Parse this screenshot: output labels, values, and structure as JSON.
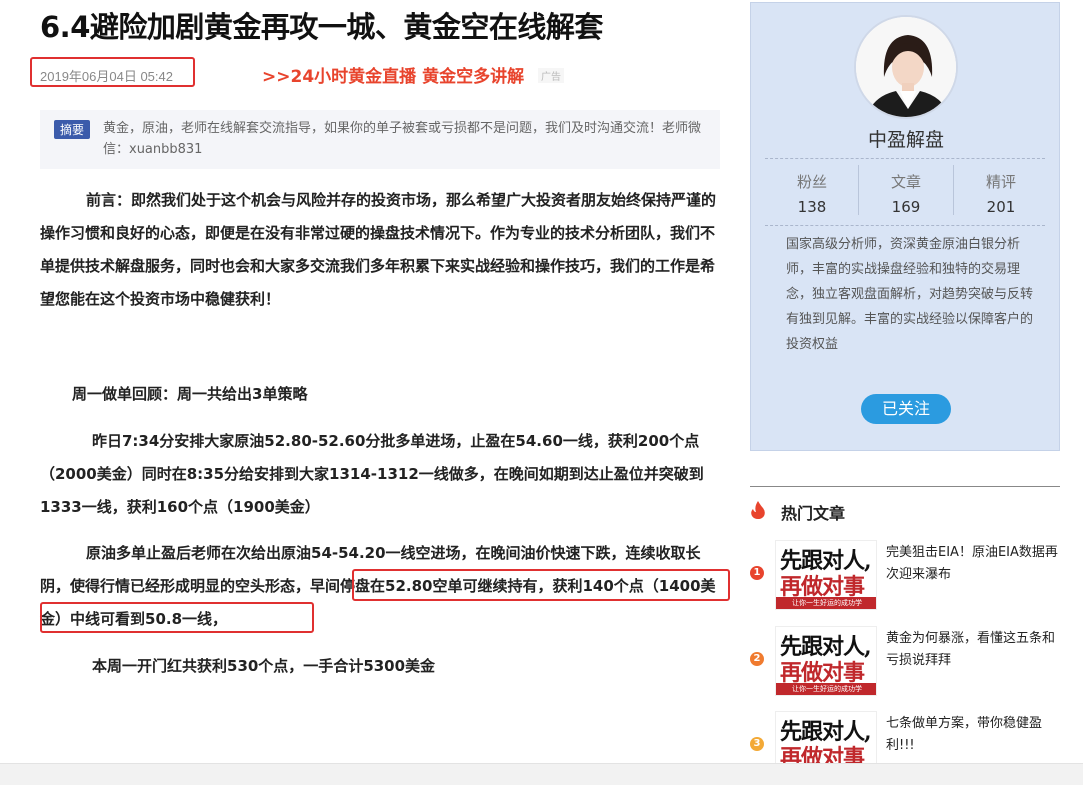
{
  "article": {
    "title": "6.4避险加剧黄金再攻一城、黄金空在线解套",
    "date": "2019年06月04日 05:42",
    "ad_link": ">>24小时黄金直播 黄金空多讲解",
    "ad_tag": "广告",
    "summary_label": "摘要",
    "summary_text": "黄金，原油，老师在线解套交流指导，如果你的单子被套或亏损都不是问题，我们及时沟通交流！老师微信：xuanbb831",
    "paragraphs": {
      "p1": "前言：即然我们处于这个机会与风险并存的投资市场，那么希望广大投资者朋友始终保持严谨的操作习惯和良好的心态，即便是在没有非常过硬的操盘技术情况下。作为专业的技术分析团队，我们不单提供技术解盘服务，同时也会和大家多交流我们多年积累下来实战经验和操作技巧，我们的工作是希望您能在这个投资市场中稳健获利！",
      "p2": "周一做单回顾：周一共给出3单策略",
      "p3": "昨日7:34分安排大家原油52.80-52.60分批多单进场，止盈在54.60一线，获利200个点（2000美金）同时在8:35分给安排到大家1314-1312一线做多，在晚间如期到达止盈位并突破到1333一线，获利160个点（1900美金）",
      "p4": "原油多单止盈后老师在次给出原油54-54.20一线空进场，在晚间油价快速下跌，连续收取长阴，使得行情已经形成明显的空头形态，早间停盘在52.80空单可继续持有，获利140个点（1400美金）中线可看到50.8一线，",
      "p5": "本周一开门红共获利530个点，一手合计5300美金"
    }
  },
  "profile": {
    "name": "中盈解盘",
    "stats": [
      {
        "label": "粉丝",
        "value": "138"
      },
      {
        "label": "文章",
        "value": "169"
      },
      {
        "label": "精评",
        "value": "201"
      }
    ],
    "description": "国家高级分析师，资深黄金原油白银分析师，丰富的实战操盘经验和独特的交易理念，独立客观盘面解析，对趋势突破与反转有独到见解。丰富的实战经验以保障客户的投资权益",
    "follow_label": "已关注"
  },
  "hot": {
    "title": "热门文章",
    "thumb_line1": "先跟对人,",
    "thumb_line2": "再做对事",
    "thumb_bar": "让你一生好运的成功学",
    "items": [
      {
        "num": "1",
        "color": "#e8442d",
        "text": "完美狙击EIA！原油EIA数据再次迎来瀑布"
      },
      {
        "num": "2",
        "color": "#f07b2f",
        "text": "黄金为何暴涨，看懂这五条和亏损说拜拜"
      },
      {
        "num": "3",
        "color": "#f3a936",
        "text": "七条做单方案，带你稳健盈利!!!"
      }
    ]
  }
}
